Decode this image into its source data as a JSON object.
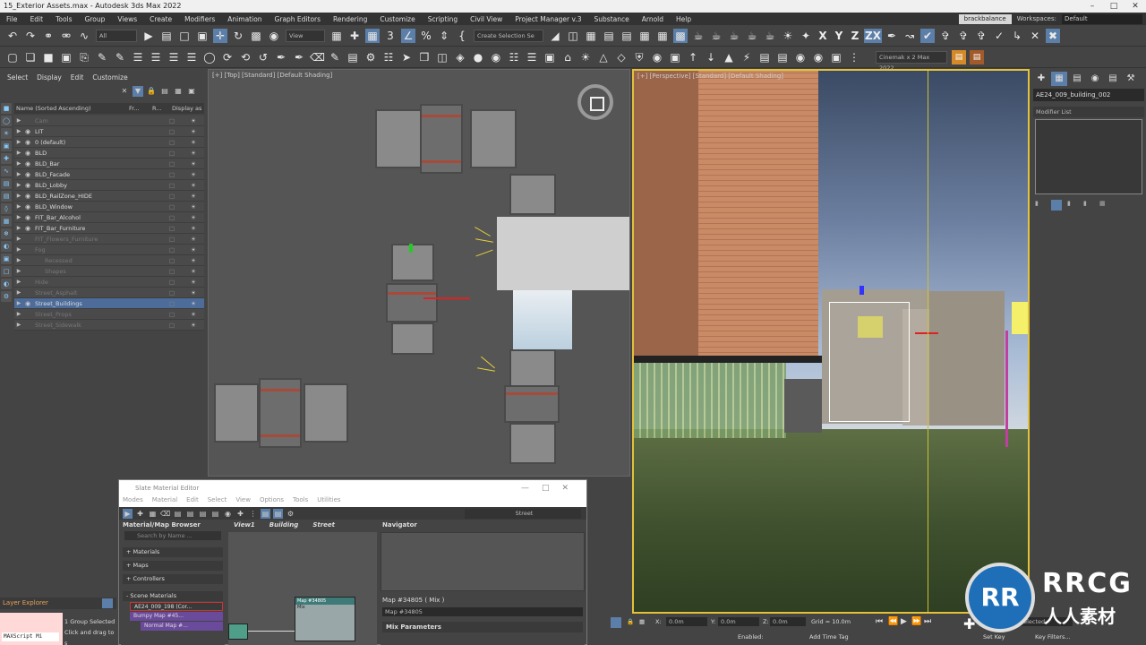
{
  "window": {
    "title": "15_Exterior Assets.max - Autodesk 3ds Max 2022"
  },
  "menubar": {
    "items": [
      "File",
      "Edit",
      "Tools",
      "Group",
      "Views",
      "Create",
      "Modifiers",
      "Animation",
      "Graph Editors",
      "Rendering",
      "Customize",
      "Scripting",
      "Civil View",
      "Project Manager v.3",
      "Substance",
      "Arnold",
      "Help"
    ],
    "user": "brackbalance",
    "workspaces_label": "Workspaces:",
    "workspaces_value": "Default"
  },
  "toolbar1": {
    "filter_dropdown": "All",
    "view_dropdown": "View",
    "selection_set": "Create Selection Se"
  },
  "toolbar2": {
    "camera_dropdown": "Cinemak x 2 Max 2022"
  },
  "explorer": {
    "menu": [
      "Select",
      "Display",
      "Edit",
      "Customize"
    ],
    "columns": [
      "Name (Sorted Ascending)",
      "Fr...",
      "R...",
      "Display as"
    ],
    "rows": [
      {
        "name": "Cam",
        "dim": true
      },
      {
        "name": "LIT",
        "dim": false
      },
      {
        "name": "0 (default)",
        "dim": false
      },
      {
        "name": "BLD",
        "dim": false
      },
      {
        "name": "BLD_Bar",
        "dim": false
      },
      {
        "name": "BLD_Facade",
        "dim": false
      },
      {
        "name": "BLD_Lobby",
        "dim": false
      },
      {
        "name": "BLD_RailZone_HIDE",
        "dim": false
      },
      {
        "name": "BLD_Window",
        "dim": false
      },
      {
        "name": "FIT_Bar_Alcohol",
        "dim": false
      },
      {
        "name": "FIT_Bar_Furniture",
        "dim": false
      },
      {
        "name": "FIT_Flowers_Furniture",
        "dim": true
      },
      {
        "name": "Fog",
        "dim": true
      },
      {
        "name": "Recessed",
        "dim": true
      },
      {
        "name": "Shapes",
        "dim": true
      },
      {
        "name": "Hide",
        "dim": true
      },
      {
        "name": "Street_Asphalt",
        "dim": true
      },
      {
        "name": "Street_Buildings",
        "dim": false
      },
      {
        "name": "Street_Props",
        "dim": true
      },
      {
        "name": "Street_Sidewalk",
        "dim": true
      }
    ],
    "layer_explorer_label": "Layer Explorer",
    "listener": "MAXScript Mi",
    "status_lines": [
      "1 Group Selected",
      "Click and drag to s"
    ]
  },
  "viewports": {
    "top_label": "[+] [Top] [Standard] [Default Shading]",
    "persp_label": "[+] [Perspective] [Standard] [Default Shading]"
  },
  "command_panel": {
    "object_name": "AE24_009_building_002",
    "modifier_list": "Modifier List"
  },
  "material_editor": {
    "title": "Slate Material Editor",
    "menu": [
      "Modes",
      "Material",
      "Edit",
      "Select",
      "View",
      "Options",
      "Tools",
      "Utilities"
    ],
    "view_dropdown": "Street",
    "browser_title": "Material/Map Browser",
    "search_placeholder": "Search by Name ...",
    "groups": [
      "+ Materials",
      "+ Maps",
      "+ Controllers",
      "- Scene Materials"
    ],
    "scene_items": [
      "AE24_009_198 (Cor...",
      "Bumpy Map #45...",
      "Normal Map #..."
    ],
    "view_tabs": [
      "View1",
      "Building",
      "Street"
    ],
    "node_title": "Map #34805",
    "node_sub": "Mix",
    "navigator_title": "Navigator",
    "map_header": "Map #34805  ( Mix )",
    "map_field": "Map #34805",
    "rollout": "Mix Parameters"
  },
  "statusbar": {
    "x_value": "0.0m",
    "y_value": "0.0m",
    "z_value": "0.0m",
    "grid": "Grid = 10.0m",
    "enabled": "Enabled:",
    "add_time_tag": "Add Time Tag",
    "set_key": "Set Key",
    "key_filters": "Key Filters...",
    "selected": "Selected"
  },
  "watermark": {
    "badge": "RRCG",
    "cn": "人人素材"
  }
}
